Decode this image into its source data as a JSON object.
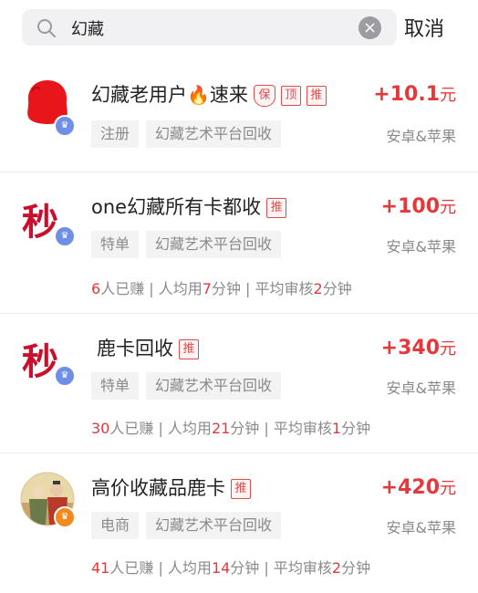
{
  "search": {
    "value": "幻藏",
    "clear_icon": "×",
    "cancel_label": "取消"
  },
  "items": [
    {
      "title": "幻藏老用户",
      "title_suffix": "速来",
      "tags": [
        "保",
        "顶",
        "推"
      ],
      "price": "+10.1",
      "unit": "元",
      "chips": [
        "注册",
        "幻藏艺术平台回收"
      ],
      "platform": "安卓&苹果"
    },
    {
      "avatar_char": "秒",
      "title": "one幻藏所有卡都收",
      "tags": [
        "推"
      ],
      "price": "+100",
      "unit": "元",
      "chips": [
        "特单",
        "幻藏艺术平台回收"
      ],
      "platform": "安卓&苹果",
      "stats": {
        "earned": "6",
        "earned_suffix": "人已赚 | 人均用",
        "avg_use": "7",
        "avg_suffix": "分钟 | 平均审核",
        "review": "2",
        "review_suffix": "分钟"
      }
    },
    {
      "avatar_char": "秒",
      "title": "鹿卡回收",
      "tags": [
        "推"
      ],
      "price": "+340",
      "unit": "元",
      "chips": [
        "特单",
        "幻藏艺术平台回收"
      ],
      "platform": "安卓&苹果",
      "stats": {
        "earned": "30",
        "earned_suffix": "人已赚 | 人均用",
        "avg_use": "21",
        "avg_suffix": "分钟 | 平均审核",
        "review": "1",
        "review_suffix": "分钟"
      }
    },
    {
      "title": "高价收藏品鹿卡",
      "tags": [
        "推"
      ],
      "price": "+420",
      "unit": "元",
      "chips": [
        "电商",
        "幻藏艺术平台回收"
      ],
      "platform": "安卓&苹果",
      "stats": {
        "earned": "41",
        "earned_suffix": "人已赚 | 人均用",
        "avg_use": "14",
        "avg_suffix": "分钟 | 平均审核",
        "review": "2",
        "review_suffix": "分钟"
      }
    }
  ],
  "colors": {
    "accent": "#e5383b",
    "muted": "#8a8a8a",
    "badge_blue": "#6f8fe6",
    "badge_orange": "#f08a1e"
  },
  "icons": {
    "search": "search-icon",
    "clear": "clear-icon",
    "fire": "fire-icon",
    "shield": "shield-icon",
    "verified": "verified-badge-icon"
  }
}
